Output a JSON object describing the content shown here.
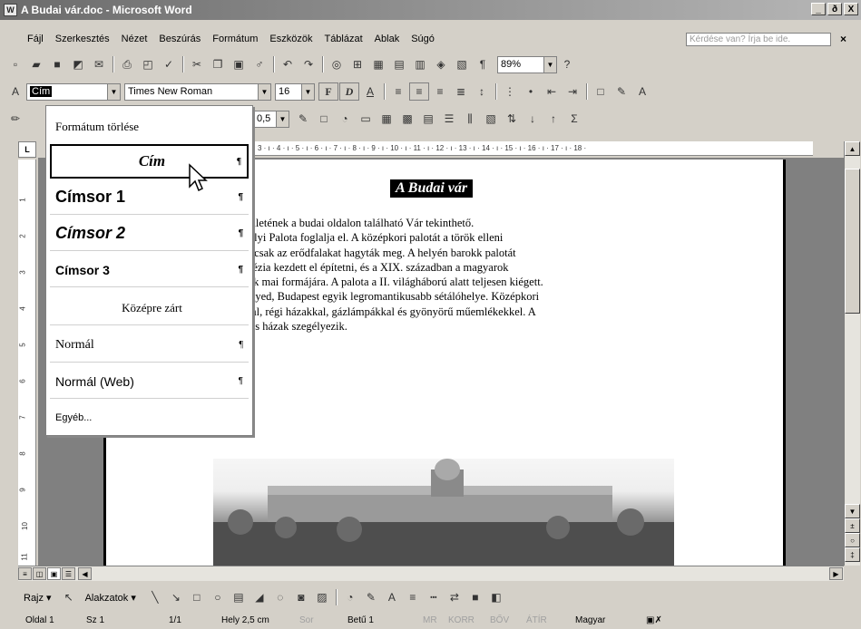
{
  "window": {
    "title": "A Budai vár.doc - Microsoft Word",
    "app_icon": "W",
    "minimize": "_",
    "restore": "ð",
    "close": "X"
  },
  "menu": {
    "items": [
      "Fájl",
      "Szerkesztés",
      "Nézet",
      "Beszúrás",
      "Formátum",
      "Eszközök",
      "Táblázat",
      "Ablak",
      "Súgó"
    ],
    "help_placeholder": "Kérdése van? Írja be ide.",
    "close": "×"
  },
  "formatting": {
    "style": "Cím",
    "font": "Times New Roman",
    "size": "16",
    "zoom": "89%",
    "bold": "F",
    "italic": "D",
    "underline": "A"
  },
  "toolbar3": {
    "line_width": "0,5"
  },
  "ruler": {
    "marks": "3 · ı · 4 · ı · 5 · ı · 6 · ı · 7 · ı · 8 · ı · 9 · ı · 10 · ı · 11 · ı · 12 · ı · 13 · ı · 14 · ı · 15 · ı · 16 · ı · 17 · ı · 18 ·",
    "corner": "L",
    "vmarks": [
      "1",
      "2",
      "3",
      "4",
      "5",
      "6",
      "7",
      "8",
      "9",
      "10",
      "11"
    ]
  },
  "style_menu": {
    "clear": "Formátum törlése",
    "items": [
      {
        "label": "Cím",
        "mark": "¶"
      },
      {
        "label": "Címsor 1",
        "mark": "¶"
      },
      {
        "label": "Címsor 2",
        "mark": "¶"
      },
      {
        "label": "Címsor 3",
        "mark": "¶"
      },
      {
        "label": "Középre zárt",
        "mark": ""
      },
      {
        "label": "Normál",
        "mark": "¶"
      },
      {
        "label": "Normál (Web)",
        "mark": "¶"
      }
    ],
    "more": "Egyéb..."
  },
  "document": {
    "title": "A Budai vár",
    "lines": [
      "legszebb épületének a budai oldalon található Vár tekinthető.",
      "részét a Királyi Palota foglalja el. A középkori palotát a török elleni",
      "bolták le, és csak az erődfalakat hagyták meg. A helyén barokk palotát",
      "et Mária Terézia kezdett el építetni, és a XIX. században a magyarok",
      "ére bővítettek mai formájára. A palota a II. világháború alatt teljesen kiégett.",
      "sze a Várnegyed, Budapest egyik legromantikusabb sétálóhelye. Középkori",
      "latos utcákkal, régi házakkal, gázlámpákkal és gyönyörű műemlékekkel. A",
      "zat színes, kis házak szegélyezik."
    ]
  },
  "drawing": {
    "draw": "Rajz ▾",
    "shapes": "Alakzatok ▾"
  },
  "status": {
    "page": "Oldal 1",
    "section": "Sz 1",
    "pages": "1/1",
    "position": "Hely 2,5 cm",
    "line": "Sor",
    "column": "Betű 1",
    "rec": "MR",
    "trk": "KORR",
    "ext": "BŐV",
    "ovr": "ÁTÍR",
    "language": "Magyar"
  }
}
